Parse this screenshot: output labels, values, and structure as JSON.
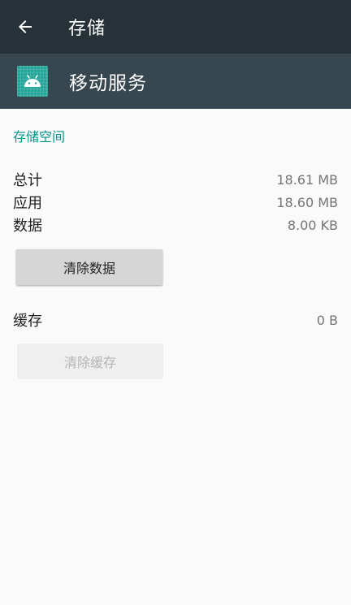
{
  "toolbar": {
    "title": "存储",
    "back_icon": "arrow-back-icon"
  },
  "app": {
    "name": "移动服务",
    "icon": "android-icon",
    "header_color": "#37474f"
  },
  "storage": {
    "section_title": "存储空间",
    "rows": [
      {
        "label": "总计",
        "value": "18.61 MB"
      },
      {
        "label": "应用",
        "value": "18.60 MB"
      },
      {
        "label": "数据",
        "value": "8.00 KB"
      }
    ],
    "clear_data_label": "清除数据"
  },
  "cache": {
    "label": "缓存",
    "value": "0 B",
    "clear_cache_label": "清除缓存"
  },
  "colors": {
    "toolbar": "#263238",
    "accent": "#009688",
    "background": "#fafafa"
  }
}
